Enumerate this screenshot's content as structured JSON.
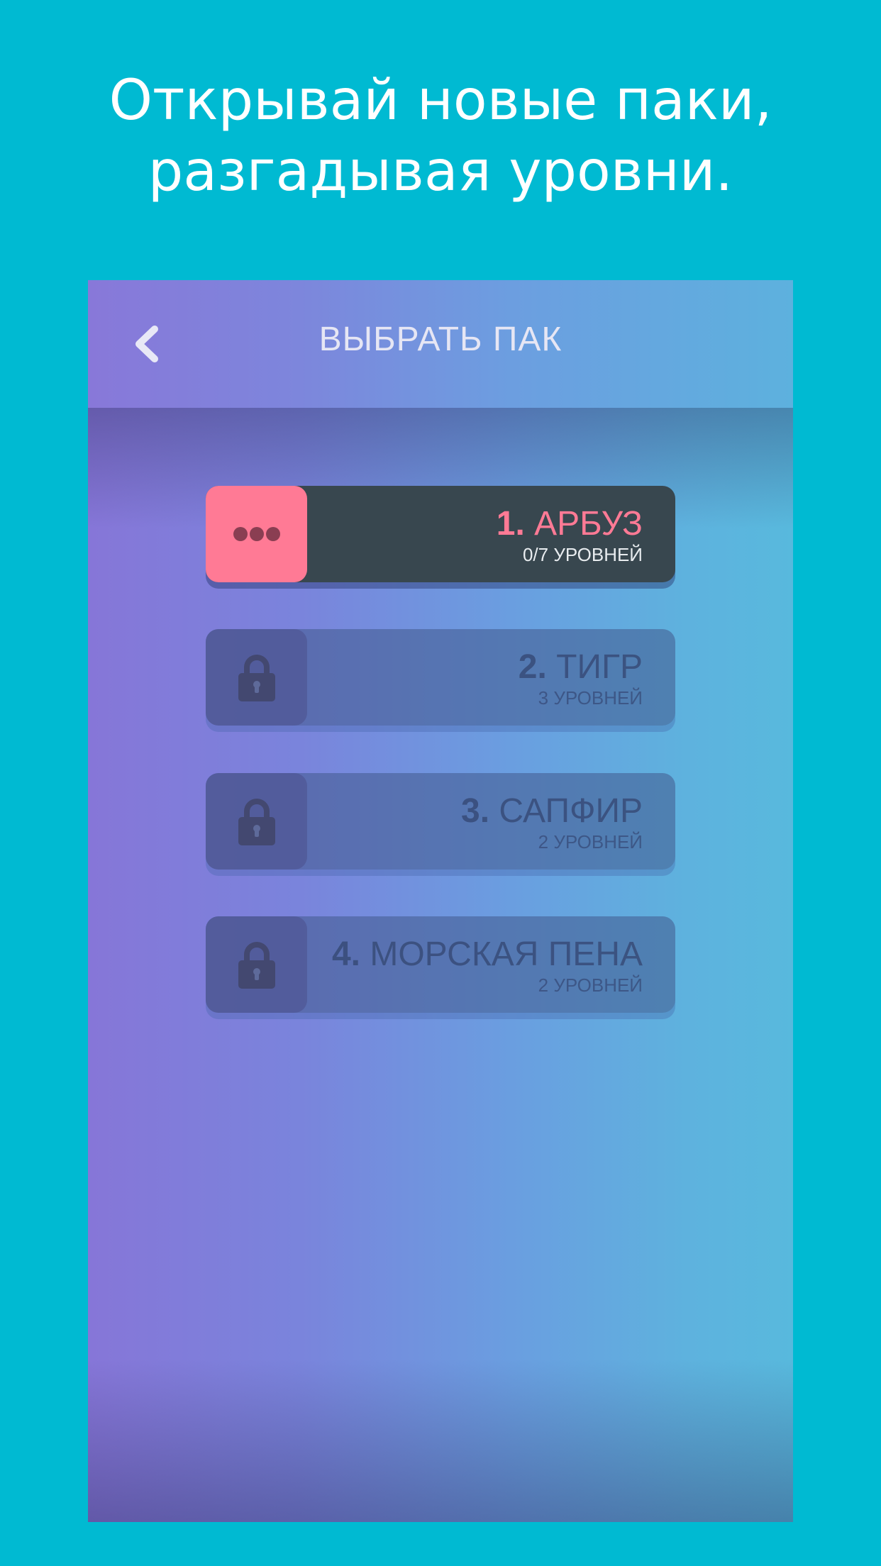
{
  "headline": {
    "line1": "Открывай новые паки,",
    "line2": "разгадывая уровни."
  },
  "colors": {
    "background": "#00BAD2",
    "accent_pink": "#FF7A95",
    "active_card": "#38474F",
    "gradient_left": "#8676D8",
    "gradient_right": "#58B9DD"
  },
  "navbar": {
    "back_icon": "chevron-left-icon",
    "title": "ВЫБРАТЬ ПАК"
  },
  "packs": [
    {
      "number": "1.",
      "name": "АРБУЗ",
      "levels": "0/7 УРОВНЕЙ",
      "state": "active",
      "icon": "ellipsis-icon"
    },
    {
      "number": "2.",
      "name": "ТИГР",
      "levels": "3 УРОВНЕЙ",
      "state": "locked",
      "icon": "lock-icon"
    },
    {
      "number": "3.",
      "name": "САПФИР",
      "levels": "2 УРОВНЕЙ",
      "state": "locked",
      "icon": "lock-icon"
    },
    {
      "number": "4.",
      "name": "МОРСКАЯ ПЕНА",
      "levels": "2 УРОВНЕЙ",
      "state": "locked",
      "icon": "lock-icon"
    }
  ]
}
